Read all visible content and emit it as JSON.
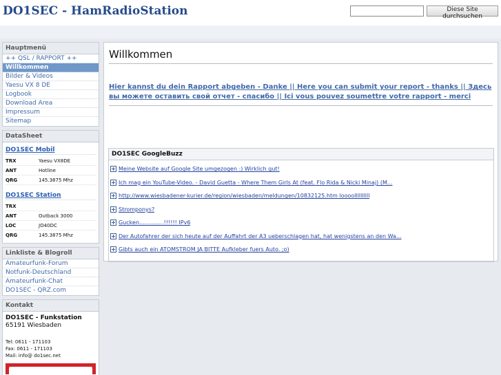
{
  "header": {
    "title": "DO1SEC - HamRadioStation",
    "search": {
      "value": "",
      "placeholder": ""
    },
    "search_button": "Diese Site durchsuchen"
  },
  "sidebar": {
    "menu": {
      "title": "Hauptmenü",
      "items": [
        {
          "label": "++ QSL / RAPPORT ++"
        },
        {
          "label": "Willkommen",
          "active": true
        },
        {
          "label": "Bilder & Videos"
        },
        {
          "label": "Yaesu VX 8 DE"
        },
        {
          "label": "Logbook"
        },
        {
          "label": "Download Area"
        },
        {
          "label": "Impressum"
        },
        {
          "label": "Sitemap"
        }
      ]
    },
    "datasheet": {
      "title": "DataSheet",
      "mobil": {
        "heading": "DO1SEC Mobil",
        "rows": [
          {
            "key": "TRX",
            "value": "Yaesu VX8DE"
          },
          {
            "key": "ANT",
            "value": "Hotline"
          },
          {
            "key": "QRG",
            "value": "145.3875 Mhz"
          }
        ]
      },
      "station": {
        "heading": "DO1SEC Station",
        "rows": [
          {
            "key": "TRX",
            "value": ""
          },
          {
            "key": "ANT",
            "value": "Outback 3000"
          },
          {
            "key": "LOC",
            "value": "JO40DC"
          },
          {
            "key": "QRG",
            "value": "145.3875 Mhz"
          }
        ]
      }
    },
    "links": {
      "title": "Linkliste & Blogroll",
      "items": [
        {
          "label": "Amateurfunk-Forum"
        },
        {
          "label": "Notfunk-Deutschland"
        },
        {
          "label": "Amateurfunk-Chat"
        },
        {
          "label": "DO1SEC - QRZ.com"
        }
      ]
    },
    "contact": {
      "title": "Kontakt",
      "name": "DO1SEC - Funkstation",
      "city": "65191 Wiesbaden",
      "tel": "Tel:  0611 - 171103",
      "fax": "Fax:  0611 - 171103",
      "mail": "Mail: info@ do1sec.net"
    }
  },
  "main": {
    "title": "Willkommen",
    "report_link": "Hier kannst du dein Rapport abgeben - Danke || Here you can submit your report - thanks || Здесь вы можете оставить свой отчет - спасибо || Ici vous pouvez soumettre votre rapport - merci",
    "buzz": {
      "title": "DO1SEC GoogleBuzz",
      "items": [
        {
          "text": "Meine Website auf Google Site umgezogen :) Wirklich gut!"
        },
        {
          "text": "Ich mag ein YouTube-Video. - David Guetta - Where Them Girls At (feat. Flo Rida & Nicki Minaj) (M..."
        },
        {
          "text": "http://www.wiesbadener-kurier.de/region/wiesbaden/meldungen/10832125.htm loooollllllllll"
        },
        {
          "text": "Stromponys?"
        },
        {
          "text": "Gucken..............!!!!!! IPv6"
        },
        {
          "text": "Der Autofahrer der sich heute auf der Auffahrt der A3 ueberschlagen hat, hat wenigstens an den Wa..."
        },
        {
          "text": "Gibts auch ein ATOMSTROM JA BITTE Aufkleber fuers Auto. ;o)"
        }
      ]
    }
  },
  "colors": {
    "title_blue": "#254b8c",
    "link_blue": "#4169a8",
    "active_bg": "#6f97c9",
    "logo_red": "#d3232a"
  }
}
